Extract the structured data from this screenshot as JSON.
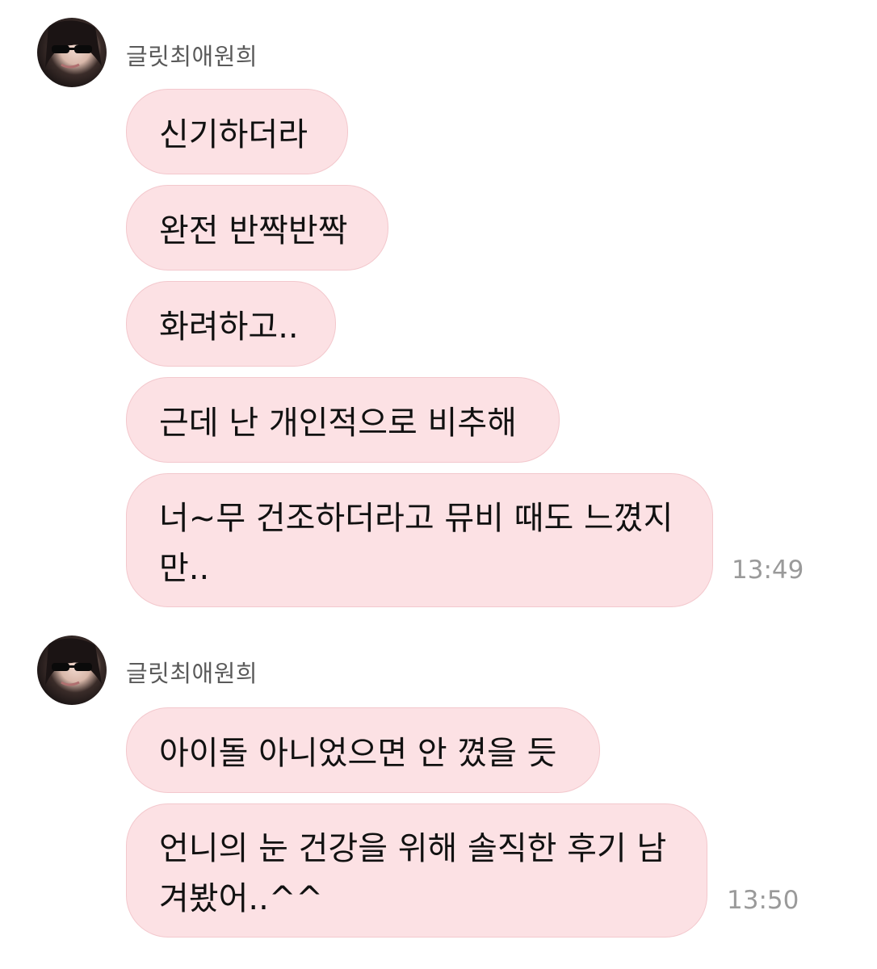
{
  "groups": [
    {
      "sender": "글릿최애원희",
      "avatar_icon": "profile-photo-sunglasses",
      "messages": [
        "신기하더라",
        "완전 반짝반짝",
        "화려하고..",
        "근데 난 개인적으로 비추해",
        "너~무 건조하더라고 뮤비 때도 느꼈지만.."
      ],
      "time": "13:49"
    },
    {
      "sender": "글릿최애원희",
      "avatar_icon": "profile-photo-sunglasses",
      "messages": [
        "아이돌 아니었으면 안 꼈을 듯",
        "언니의 눈 건강을 위해 솔직한 후기 남겨봤어..^^"
      ],
      "time": "13:50"
    }
  ],
  "colors": {
    "bubble": "#fce1e4",
    "bubble_border": "#f3c8cd",
    "time_text": "#9a9a9a",
    "sender_text": "#5a5a5a"
  }
}
